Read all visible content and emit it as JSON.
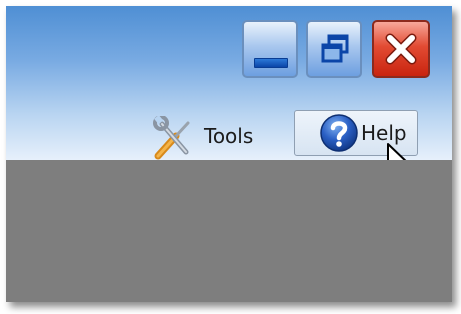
{
  "window": {
    "caption_buttons": {
      "minimize_icon": "minimize-icon",
      "restore_icon": "restore-icon",
      "close_icon": "close-icon"
    }
  },
  "toolbar": {
    "tools_label": "Tools",
    "tools_icon": "tools-icon",
    "help_label": "Help",
    "help_icon": "help-icon"
  },
  "colors": {
    "titlebar_top": "#4f8fd4",
    "titlebar_bottom": "#e6f0fb",
    "content_background": "#7e7e7e",
    "close_button": "#d83a22",
    "help_icon_blue": "#1f4fae"
  }
}
